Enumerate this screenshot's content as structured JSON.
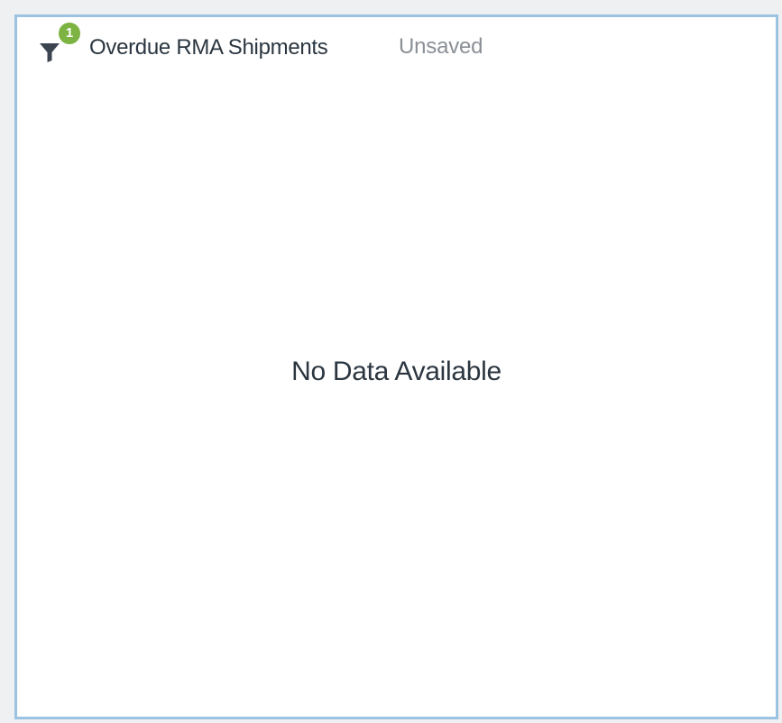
{
  "widget": {
    "title": "Overdue RMA Shipments",
    "status": "Unsaved",
    "filter": {
      "icon": "filter-icon",
      "active_count": "1"
    },
    "empty_message": "No Data Available"
  },
  "colors": {
    "border": "#9cc3e1",
    "badge": "#7cb342",
    "filter_icon": "#3b4450",
    "title_text": "#2b3640",
    "status_text": "#8a9096"
  }
}
